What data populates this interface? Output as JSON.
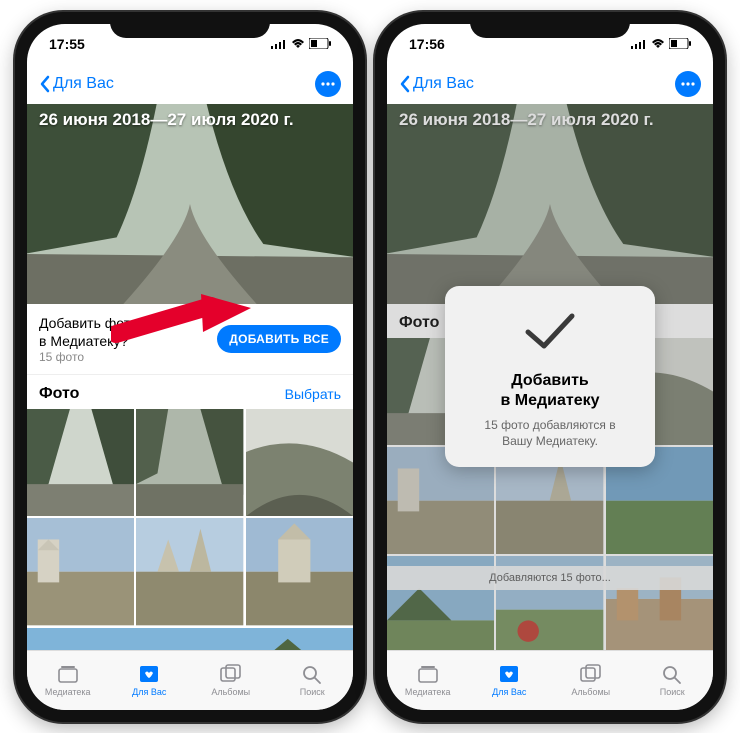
{
  "left": {
    "status": {
      "time": "17:55"
    },
    "nav": {
      "back": "Для Вас"
    },
    "hero_title": "26 июня 2018—27 июля 2020 г.",
    "action": {
      "question_line1": "Добавить фото",
      "question_line2": "в Медиатеку?",
      "subtitle": "15 фото",
      "button": "ДОБАВИТЬ ВСЕ"
    },
    "section": {
      "title": "Фото",
      "select": "Выбрать"
    }
  },
  "right": {
    "status": {
      "time": "17:56"
    },
    "nav": {
      "back": "Для Вас"
    },
    "hero_title": "26 июня 2018—27 июля 2020 г.",
    "section": {
      "title": "Фото"
    },
    "popup": {
      "title_line1": "Добавить",
      "title_line2": "в Медиатеку",
      "sub_line1": "15 фото добавляются в",
      "sub_line2": "Вашу Медиатеку."
    },
    "adding_status": "Добавляются 15 фото..."
  },
  "tabs": {
    "library": "Медиатека",
    "for_you": "Для Вас",
    "albums": "Альбомы",
    "search": "Поиск"
  }
}
